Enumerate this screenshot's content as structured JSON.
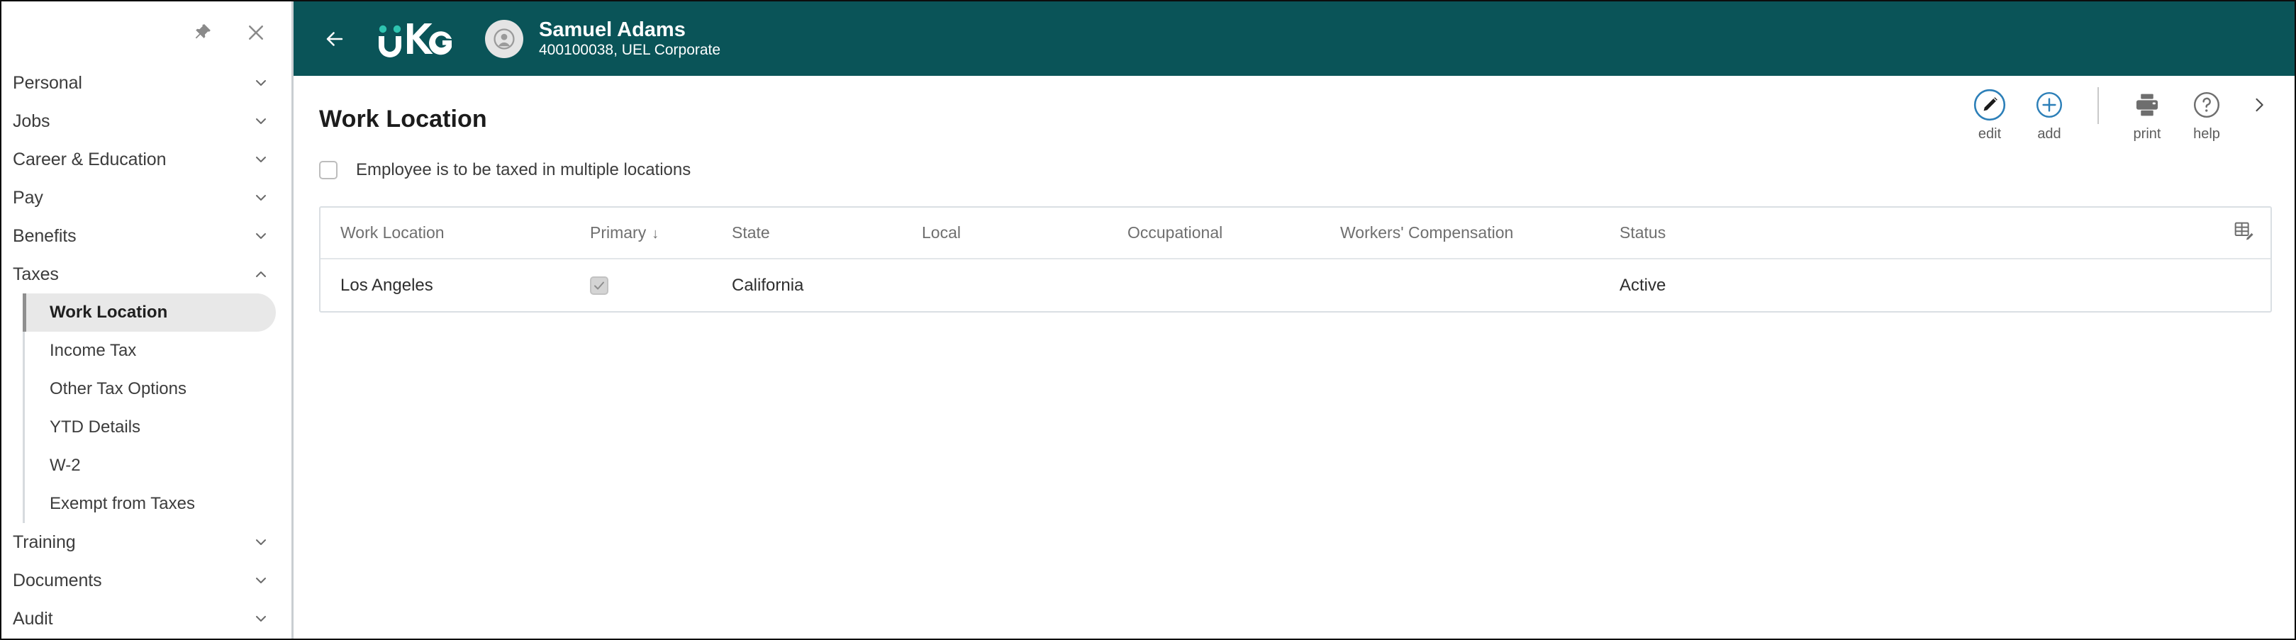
{
  "sidebar": {
    "pin_icon": "pin-icon",
    "close_icon": "close-icon",
    "groups": [
      {
        "label": "Personal",
        "expanded": false
      },
      {
        "label": "Jobs",
        "expanded": false
      },
      {
        "label": "Career & Education",
        "expanded": false
      },
      {
        "label": "Pay",
        "expanded": false
      },
      {
        "label": "Benefits",
        "expanded": false
      },
      {
        "label": "Taxes",
        "expanded": true
      },
      {
        "label": "Training",
        "expanded": false
      },
      {
        "label": "Documents",
        "expanded": false
      },
      {
        "label": "Audit",
        "expanded": false
      }
    ],
    "taxes_items": [
      {
        "label": "Work Location",
        "active": true
      },
      {
        "label": "Income Tax",
        "active": false
      },
      {
        "label": "Other Tax Options",
        "active": false
      },
      {
        "label": "YTD Details",
        "active": false
      },
      {
        "label": "W-2",
        "active": false
      },
      {
        "label": "Exempt from Taxes",
        "active": false
      }
    ]
  },
  "topbar": {
    "back_icon": "arrow-left-icon",
    "logo_text": "uKG",
    "avatar_icon": "user-avatar-icon",
    "employee_name": "Samuel Adams",
    "employee_meta": "400100038, UEL Corporate",
    "background_color": "#0a5458",
    "logo_accent_color": "#2ec4b0"
  },
  "page": {
    "title": "Work Location"
  },
  "actions": {
    "edit_label": "edit",
    "edit_icon": "pencil-icon",
    "add_label": "add",
    "add_icon": "plus-circle-icon",
    "print_label": "print",
    "print_icon": "printer-icon",
    "help_label": "help",
    "help_icon": "question-circle-icon",
    "more_icon": "chevron-right-icon",
    "accent_color": "#2c7fb8"
  },
  "multi_location": {
    "label": "Employee is to be taxed in multiple locations",
    "checked": false
  },
  "table": {
    "columns": [
      "Work Location",
      "Primary",
      "State",
      "Local",
      "Occupational",
      "Workers' Compensation",
      "Status"
    ],
    "sort_column": "Primary",
    "sort_direction": "desc",
    "sort_glyph": "↓",
    "settings_icon": "table-edit-icon",
    "rows": [
      {
        "work_location": "Los Angeles",
        "primary": true,
        "state": "California",
        "local": "",
        "occupational": "",
        "workers_compensation": "",
        "status": "Active"
      }
    ]
  }
}
